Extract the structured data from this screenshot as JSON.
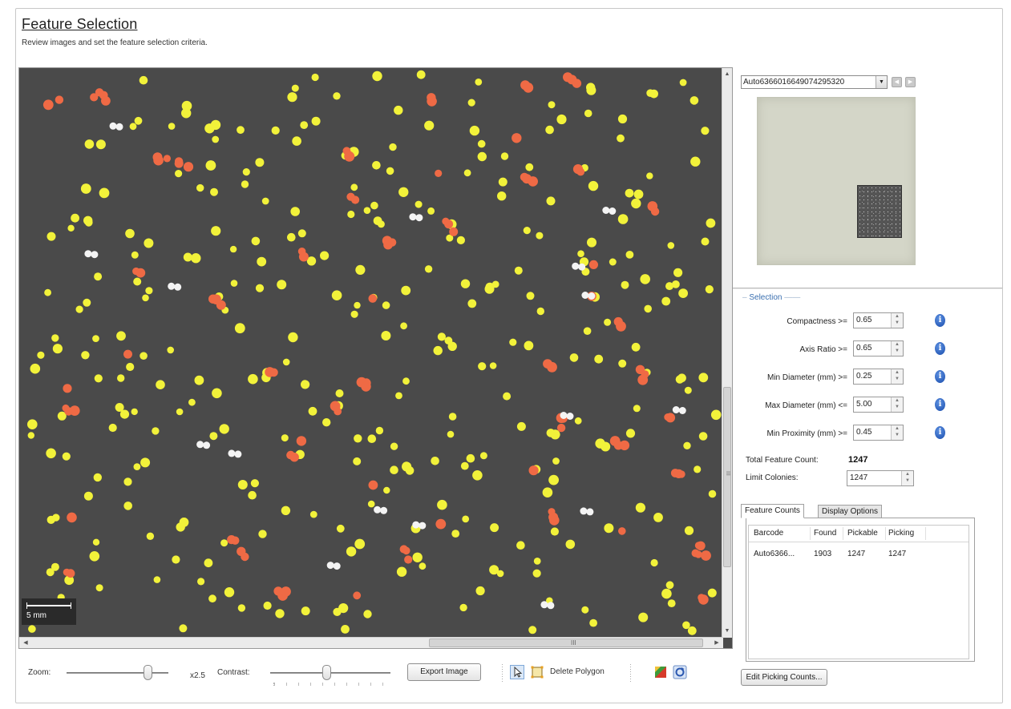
{
  "header": {
    "title": "Feature Selection",
    "subtitle": "Review images and set the feature selection criteria."
  },
  "viewer": {
    "scale_label": "5 mm",
    "hscroll_grip": "III",
    "vscroll_grip": "III",
    "colors": {
      "background": "#4a4a4a",
      "selected_colony": "#f2f23a",
      "rejected_colony": "#ef6a45",
      "excluded_colony": "#f4f4f4"
    }
  },
  "toolbar": {
    "zoom_label": "Zoom:",
    "zoom_value": "x2.5",
    "contrast_label": "Contrast:",
    "export_label": "Export Image",
    "delete_polygon_label": "Delete Polygon",
    "icons": [
      "pointer-icon",
      "polygon-icon",
      "color-map-icon",
      "refresh-icon"
    ]
  },
  "right_panel": {
    "image_select": "Auto6366016649074295320",
    "selection": {
      "legend": "Selection",
      "fields": [
        {
          "label": "Compactness >=",
          "value": "0.65"
        },
        {
          "label": "Axis Ratio >=",
          "value": "0.65"
        },
        {
          "label": "Min Diameter (mm) >=",
          "value": "0.25"
        },
        {
          "label": "Max Diameter (mm) <=",
          "value": "5.00"
        },
        {
          "label": "Min Proximity (mm) >=",
          "value": "0.45"
        }
      ],
      "info_glyph": "i",
      "total_label": "Total Feature Count:",
      "total_value": "1247",
      "limit_label": "Limit Colonies:",
      "limit_value": "1247"
    },
    "tabs": [
      "Feature Counts",
      "Display Options"
    ],
    "table": {
      "columns": [
        "Barcode",
        "Found",
        "Pickable",
        "Picking"
      ],
      "rows": [
        [
          "Auto6366...",
          "1903",
          "1247",
          "1247"
        ]
      ]
    },
    "edit_button": "Edit Picking Counts..."
  }
}
